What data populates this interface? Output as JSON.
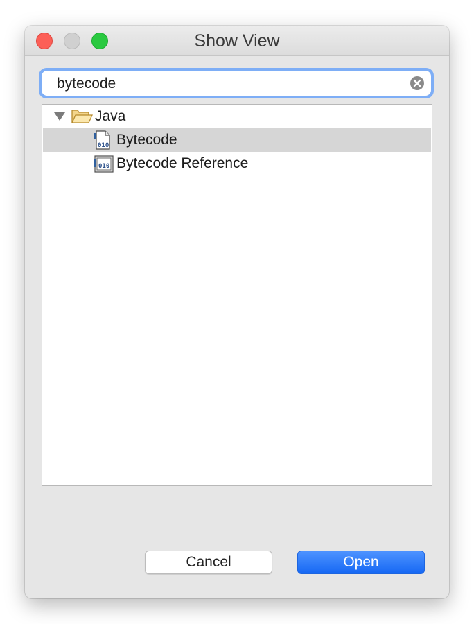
{
  "window": {
    "title": "Show View"
  },
  "search": {
    "value": "bytecode"
  },
  "tree": {
    "items": [
      {
        "label": "Java",
        "type": "folder",
        "expanded": true,
        "icon": "folder-open-icon"
      },
      {
        "label": "Bytecode",
        "type": "view",
        "selected": true,
        "icon": "bytecode-view-icon"
      },
      {
        "label": "Bytecode Reference",
        "type": "view",
        "selected": false,
        "icon": "bytecode-reference-icon"
      }
    ]
  },
  "buttons": {
    "cancel_label": "Cancel",
    "open_label": "Open"
  },
  "colors": {
    "accent": "#1a6cf5",
    "selection": "#d6d6d6",
    "close": "#fc5f57",
    "zoom": "#2ac940"
  }
}
